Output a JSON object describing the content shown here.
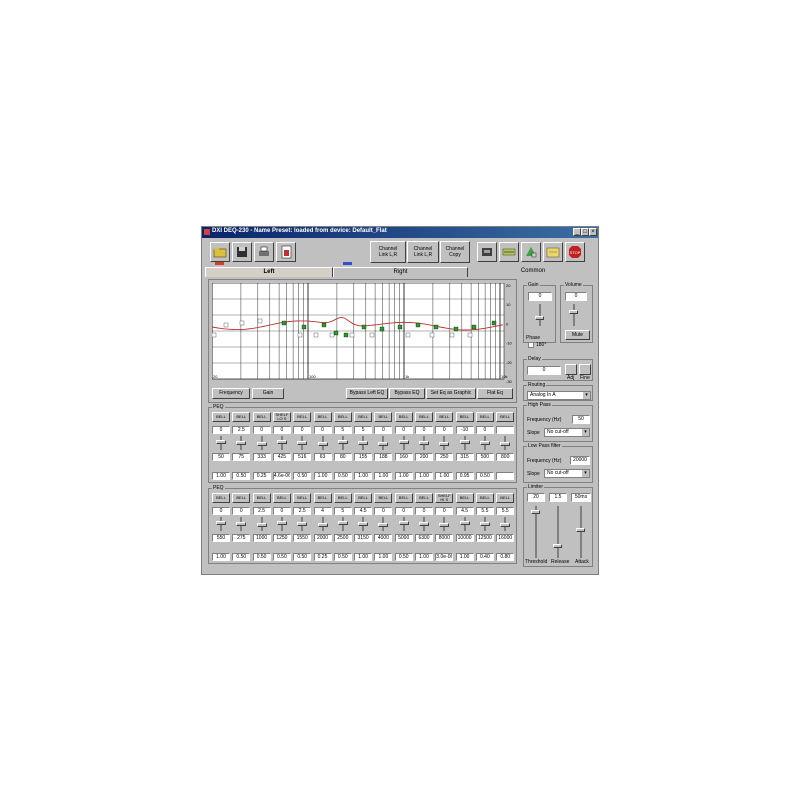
{
  "window": {
    "title": "DXI DEQ-230 - Name Preset: loaded from device: Default_Flat",
    "minimize": "_",
    "maximize": "□",
    "close": "×"
  },
  "colors": {
    "titlebar": "#0a246a",
    "curve": "#c03030",
    "marker_green": "#2a9a2a",
    "marker_white": "#ffffff",
    "left_indicator": "#d04030",
    "right_indicator": "#3050d0"
  },
  "toolbar": {
    "icons": [
      "open-folder-icon",
      "save-disk-icon",
      "printer-icon",
      "calculator-icon"
    ],
    "link_label": "Channel\nLink L,R",
    "channel_label": "Channel\nLink L,R",
    "copy_label": "Channel\nCopy",
    "right_icons": [
      "device-icon",
      "transfer-icon",
      "compare-icon",
      "folder-icon",
      "stop-icon"
    ]
  },
  "tabs": {
    "left": "Left",
    "right": "Right",
    "common": "Common"
  },
  "graph": {
    "x_labels": [
      "20",
      "100",
      "1k",
      "10k"
    ],
    "y_labels": [
      "20",
      "10",
      "0",
      "-10",
      "-20",
      "-30"
    ],
    "freq_button": "Frequency",
    "gain_button": "Gain",
    "bypass_left": "Bypass Left EQ",
    "bypass_right": "Bypass EQ",
    "set_graphic": "Set Eq as Graphic",
    "flat": "Flat Eq"
  },
  "peq_left": {
    "group": "PEQ",
    "filter_label": "BELL",
    "special_label": "SHELF\nLO S",
    "gains": [
      "0",
      "2.5",
      "0",
      "0",
      "0",
      "0",
      "5",
      "5",
      "0",
      "0",
      "0",
      "0",
      "-10",
      "0"
    ],
    "freqs": [
      "50",
      "75",
      "333",
      "425",
      "516",
      "63",
      "80",
      "155",
      "188",
      "160",
      "200",
      "250",
      "315",
      "500",
      "800"
    ],
    "qs": [
      "1.00",
      "0.50",
      "0.25",
      "4.6e-06",
      "0.50",
      "1.00",
      "0.50",
      "1.00",
      "1.00",
      "1.00",
      "1.00",
      "1.00",
      "0.95",
      "0.50"
    ]
  },
  "peq_right": {
    "group": "PEQ",
    "filter_label": "BELL",
    "special_label": "SHELF\nHI S",
    "gains": [
      "0",
      "0",
      "2.5",
      "0",
      "2.5",
      "4",
      "5",
      "4.5",
      "0",
      "0",
      "0",
      "0",
      "4.5",
      "5.5",
      "5.5"
    ],
    "freqs": [
      "550",
      "275",
      "1000",
      "1250",
      "1550",
      "2000",
      "2500",
      "3150",
      "4000",
      "5000",
      "6300",
      "8000",
      "10000",
      "12500",
      "16000"
    ],
    "qs": [
      "1.00",
      "0.50",
      "0.50",
      "0.50",
      "0.50",
      "0.25",
      "0.50",
      "1.00",
      "1.00",
      "0.50",
      "1.00",
      "3.0e-06",
      "1.00",
      "0.40",
      "0.80"
    ]
  },
  "common": {
    "gain_group": "Gain",
    "gain_value": "0",
    "volume_group": "Volume",
    "volume_value": "0",
    "phase_group": "Phase",
    "phase_label": "180°",
    "mute": "Mute",
    "delay_group": "Delay",
    "delay_value": "0",
    "adj_label": "Adj",
    "fine_label": "Fine",
    "routing_group": "Routing",
    "routing_value": "Analog In A",
    "highpass_group": "High Pass",
    "hp_freq_label": "Frequency (Hz)",
    "hp_freq_value": "50",
    "hp_slope_label": "Slope",
    "hp_slope_value": "No cut-off",
    "lowpass_group": "Low Pass filter",
    "lp_freq_label": "Frequency (Hz)",
    "lp_freq_value": "20000",
    "lp_slope_label": "Slope",
    "lp_slope_value": "No cut-off",
    "limiter_group": "Limiter",
    "lim_values": [
      "20",
      "1.5",
      "50ms"
    ],
    "lim_labels": [
      "Threshold",
      "Release",
      "Attack"
    ]
  }
}
